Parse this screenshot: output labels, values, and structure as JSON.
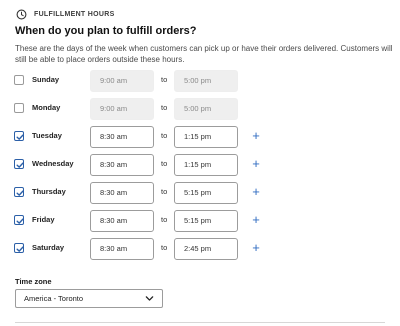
{
  "section": {
    "icon": "clock-icon",
    "title": "FULFILLMENT HOURS"
  },
  "heading": "When do you plan to fulfill orders?",
  "description": "These are the days of the week when customers can pick up or have their orders delivered. Customers will still be able to place orders outside these hours.",
  "schedule": [
    {
      "day": "Sunday",
      "checked": false,
      "start": "9:00 am",
      "to": "to",
      "end": "5:00 pm",
      "add_icon": null
    },
    {
      "day": "Monday",
      "checked": false,
      "start": "9:00 am",
      "to": "to",
      "end": "5:00 pm",
      "add_icon": null
    },
    {
      "day": "Tuesday",
      "checked": true,
      "start": "8:30 am",
      "to": "to",
      "end": "1:15 pm",
      "add_icon": "+"
    },
    {
      "day": "Wednesday",
      "checked": true,
      "start": "8:30 am",
      "to": "to",
      "end": "1:15 pm",
      "add_icon": "+"
    },
    {
      "day": "Thursday",
      "checked": true,
      "start": "8:30 am",
      "to": "to",
      "end": "5:15 pm",
      "add_icon": "+"
    },
    {
      "day": "Friday",
      "checked": true,
      "start": "8:30 am",
      "to": "to",
      "end": "5:15 pm",
      "add_icon": "+"
    },
    {
      "day": "Saturday",
      "checked": true,
      "start": "8:30 am",
      "to": "to",
      "end": "2:45 pm",
      "add_icon": "+"
    }
  ],
  "timezone": {
    "label": "Time zone",
    "value": "America - Toronto",
    "icon": "chevron-down-icon"
  },
  "colors": {
    "accent": "#2f6bc1",
    "checkbox_checked": "#2c60a8",
    "disabled_input_bg": "#efefef"
  }
}
